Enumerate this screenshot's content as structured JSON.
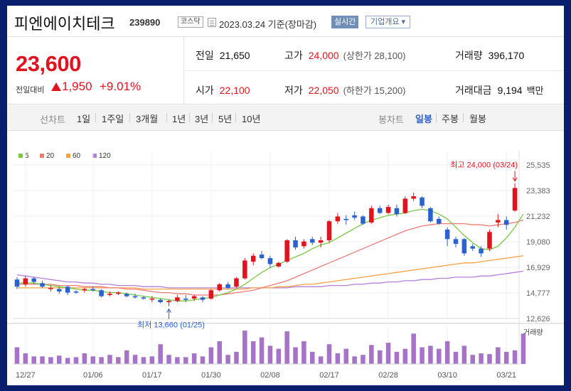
{
  "header": {
    "stock_name": "피엔에이치테크",
    "stock_code": "239890",
    "market": "코스닥",
    "date": "2023.03.24 기준(장마감)",
    "realtime_label": "실시간",
    "company_label": "기업개요 ▾"
  },
  "quote": {
    "price": "23,600",
    "change_label": "전일대비",
    "change": "1,950",
    "change_pct": "+9.01%",
    "prev_close_label": "전일",
    "prev_close": "21,650",
    "high_label": "고가",
    "high": "24,000",
    "upper_limit": "(상한가 28,100)",
    "volume_label": "거래량",
    "volume": "396,170",
    "open_label": "시가",
    "open": "22,100",
    "low_label": "저가",
    "low": "22,050",
    "lower_limit": "(하한가 15,200)",
    "amount_label": "거래대금",
    "amount": "9,194",
    "amount_unit": "백만"
  },
  "period_bar": {
    "line_label": "선차트",
    "line_items": [
      "1일",
      "1주일",
      "3개월",
      "1년",
      "3년",
      "5년",
      "10년"
    ],
    "candle_label": "봉차트",
    "candle_items": [
      "일봉",
      "주봉",
      "월봉"
    ],
    "active_candle": "일봉"
  },
  "colors": {
    "up": "#e0131e",
    "down": "#2a62d0",
    "ma5": "#7ac943",
    "ma20": "#ef7a76",
    "ma60": "#f4a244",
    "ma120": "#b57fd8"
  },
  "chart_data": {
    "type": "candlestick",
    "legend": [
      {
        "name": "5",
        "color": "#7ac943"
      },
      {
        "name": "20",
        "color": "#ef7a76"
      },
      {
        "name": "60",
        "color": "#f4a244"
      },
      {
        "name": "120",
        "color": "#b57fd8"
      }
    ],
    "y_ticks": [
      "25,535",
      "23,383",
      "21,232",
      "19,080",
      "16,929",
      "14,777",
      "12,626"
    ],
    "ylim": [
      12626,
      25535
    ],
    "x_ticks": [
      {
        "label": "12/27",
        "index": 1
      },
      {
        "label": "01/06",
        "index": 9
      },
      {
        "label": "01/17",
        "index": 16
      },
      {
        "label": "01/30",
        "index": 23
      },
      {
        "label": "02/08",
        "index": 30
      },
      {
        "label": "02/17",
        "index": 37
      },
      {
        "label": "02/28",
        "index": 44
      },
      {
        "label": "03/10",
        "index": 51
      },
      {
        "label": "03/21",
        "index": 58
      }
    ],
    "high_annotation": "최고 24,000 (03/24)",
    "high_index": 59,
    "low_annotation": "최저 13,660 (01/25)",
    "low_index": 18,
    "volume_label": "거래량",
    "candles": [
      {
        "o": 15900,
        "h": 16100,
        "l": 15100,
        "c": 15300
      },
      {
        "o": 15500,
        "h": 16200,
        "l": 15300,
        "c": 16000
      },
      {
        "o": 16000,
        "h": 16100,
        "l": 15500,
        "c": 15700
      },
      {
        "o": 15600,
        "h": 15800,
        "l": 15200,
        "c": 15300
      },
      {
        "o": 15100,
        "h": 15400,
        "l": 14900,
        "c": 15200
      },
      {
        "o": 15100,
        "h": 15300,
        "l": 14700,
        "c": 14900
      },
      {
        "o": 15300,
        "h": 15400,
        "l": 14600,
        "c": 14800
      },
      {
        "o": 14900,
        "h": 15000,
        "l": 14700,
        "c": 14800
      },
      {
        "o": 15000,
        "h": 15200,
        "l": 14800,
        "c": 15100
      },
      {
        "o": 15100,
        "h": 15300,
        "l": 14900,
        "c": 15000
      },
      {
        "o": 15000,
        "h": 15100,
        "l": 14400,
        "c": 14500
      },
      {
        "o": 14600,
        "h": 14900,
        "l": 14500,
        "c": 14700
      },
      {
        "o": 14700,
        "h": 14900,
        "l": 14600,
        "c": 14800
      },
      {
        "o": 14700,
        "h": 14800,
        "l": 14400,
        "c": 14500
      },
      {
        "o": 14500,
        "h": 14700,
        "l": 14300,
        "c": 14400
      },
      {
        "o": 14400,
        "h": 14500,
        "l": 14200,
        "c": 14300
      },
      {
        "o": 14300,
        "h": 14500,
        "l": 14000,
        "c": 14300
      },
      {
        "o": 14200,
        "h": 14300,
        "l": 13900,
        "c": 14000
      },
      {
        "o": 14000,
        "h": 14200,
        "l": 13660,
        "c": 14100
      },
      {
        "o": 14100,
        "h": 14600,
        "l": 14000,
        "c": 14400
      },
      {
        "o": 14300,
        "h": 14600,
        "l": 14000,
        "c": 14200
      },
      {
        "o": 14300,
        "h": 14600,
        "l": 14100,
        "c": 14500
      },
      {
        "o": 14400,
        "h": 14500,
        "l": 14000,
        "c": 14200
      },
      {
        "o": 14300,
        "h": 15100,
        "l": 14200,
        "c": 15000
      },
      {
        "o": 15000,
        "h": 15600,
        "l": 14900,
        "c": 15500
      },
      {
        "o": 15500,
        "h": 15700,
        "l": 15100,
        "c": 15200
      },
      {
        "o": 15300,
        "h": 16100,
        "l": 15200,
        "c": 16000
      },
      {
        "o": 16000,
        "h": 17700,
        "l": 15900,
        "c": 17500
      },
      {
        "o": 17400,
        "h": 18100,
        "l": 17100,
        "c": 17900
      },
      {
        "o": 18000,
        "h": 18300,
        "l": 17600,
        "c": 17700
      },
      {
        "o": 17700,
        "h": 17900,
        "l": 16900,
        "c": 17200
      },
      {
        "o": 17000,
        "h": 17400,
        "l": 16900,
        "c": 17300
      },
      {
        "o": 17400,
        "h": 19300,
        "l": 17300,
        "c": 19200
      },
      {
        "o": 19200,
        "h": 19500,
        "l": 18400,
        "c": 18600
      },
      {
        "o": 18700,
        "h": 19300,
        "l": 18500,
        "c": 19100
      },
      {
        "o": 19300,
        "h": 19500,
        "l": 18800,
        "c": 19000
      },
      {
        "o": 19000,
        "h": 19500,
        "l": 18600,
        "c": 19200
      },
      {
        "o": 19200,
        "h": 20900,
        "l": 19000,
        "c": 20800
      },
      {
        "o": 20800,
        "h": 21500,
        "l": 20600,
        "c": 21200
      },
      {
        "o": 21000,
        "h": 21300,
        "l": 20500,
        "c": 20900
      },
      {
        "o": 21300,
        "h": 21600,
        "l": 20900,
        "c": 21100
      },
      {
        "o": 21200,
        "h": 21300,
        "l": 20500,
        "c": 20600
      },
      {
        "o": 20700,
        "h": 22100,
        "l": 20600,
        "c": 21900
      },
      {
        "o": 21900,
        "h": 22100,
        "l": 21400,
        "c": 21500
      },
      {
        "o": 21500,
        "h": 22200,
        "l": 21400,
        "c": 22000
      },
      {
        "o": 21900,
        "h": 22200,
        "l": 21200,
        "c": 21400
      },
      {
        "o": 21500,
        "h": 22900,
        "l": 21400,
        "c": 22700
      },
      {
        "o": 22700,
        "h": 23200,
        "l": 22500,
        "c": 22900
      },
      {
        "o": 22800,
        "h": 22900,
        "l": 21900,
        "c": 22100
      },
      {
        "o": 21900,
        "h": 22000,
        "l": 20700,
        "c": 20800
      },
      {
        "o": 21000,
        "h": 21200,
        "l": 20500,
        "c": 20600
      },
      {
        "o": 20100,
        "h": 20300,
        "l": 18700,
        "c": 19300
      },
      {
        "o": 19300,
        "h": 19500,
        "l": 18600,
        "c": 18900
      },
      {
        "o": 19300,
        "h": 19400,
        "l": 17900,
        "c": 18100
      },
      {
        "o": 18700,
        "h": 18900,
        "l": 18300,
        "c": 18500
      },
      {
        "o": 18500,
        "h": 18700,
        "l": 17800,
        "c": 18100
      },
      {
        "o": 18500,
        "h": 20100,
        "l": 18300,
        "c": 19900
      },
      {
        "o": 20700,
        "h": 21400,
        "l": 20300,
        "c": 20900
      },
      {
        "o": 20900,
        "h": 21200,
        "l": 20100,
        "c": 20500
      },
      {
        "o": 21700,
        "h": 24000,
        "l": 21600,
        "c": 23600
      }
    ],
    "ma5": [
      15600,
      15600,
      15600,
      15500,
      15400,
      15300,
      15200,
      15100,
      15000,
      15000,
      14900,
      14800,
      14800,
      14700,
      14600,
      14500,
      14400,
      14300,
      14200,
      14100,
      14100,
      14200,
      14300,
      14400,
      14600,
      14800,
      15100,
      15500,
      16000,
      16500,
      16900,
      17200,
      17500,
      17800,
      18100,
      18500,
      18800,
      19000,
      19400,
      19800,
      20200,
      20600,
      20900,
      21100,
      21300,
      21400,
      21500,
      21700,
      21800,
      21700,
      21400,
      21000,
      20300,
      19600,
      19000,
      18500,
      18400,
      18700,
      19400,
      20300,
      21400
    ],
    "ma20": [
      15500,
      15500,
      15500,
      15500,
      15500,
      15400,
      15400,
      15400,
      15300,
      15300,
      15300,
      15200,
      15200,
      15100,
      15100,
      15000,
      14900,
      14800,
      14800,
      14700,
      14700,
      14600,
      14600,
      14600,
      14600,
      14700,
      14800,
      14900,
      15000,
      15200,
      15400,
      15600,
      15800,
      16100,
      16400,
      16700,
      17000,
      17300,
      17600,
      17900,
      18200,
      18500,
      18800,
      19100,
      19400,
      19700,
      20000,
      20200,
      20400,
      20500,
      20600,
      20600,
      20600,
      20600,
      20500,
      20500,
      20400,
      20500,
      20600,
      20700,
      20900
    ],
    "ma60": [
      15200,
      15200,
      15200,
      15200,
      15200,
      15200,
      15200,
      15200,
      15200,
      15200,
      15200,
      15200,
      15200,
      15200,
      15200,
      15100,
      15100,
      15100,
      15100,
      15100,
      15100,
      15100,
      15100,
      15100,
      15100,
      15100,
      15100,
      15100,
      15200,
      15200,
      15200,
      15300,
      15300,
      15400,
      15500,
      15500,
      15600,
      15700,
      15800,
      15900,
      16000,
      16100,
      16200,
      16300,
      16400,
      16500,
      16600,
      16700,
      16800,
      16900,
      17000,
      17100,
      17200,
      17300,
      17300,
      17400,
      17500,
      17600,
      17700,
      17800,
      17900
    ],
    "ma120": [
      16300,
      16200,
      16100,
      16000,
      15900,
      15800,
      15700,
      15700,
      15600,
      15600,
      15500,
      15500,
      15400,
      15400,
      15400,
      15300,
      15300,
      15300,
      15200,
      15200,
      15200,
      15200,
      15200,
      15200,
      15200,
      15200,
      15200,
      15200,
      15200,
      15200,
      15200,
      15200,
      15200,
      15300,
      15300,
      15300,
      15300,
      15400,
      15400,
      15400,
      15500,
      15500,
      15600,
      15600,
      15700,
      15700,
      15800,
      15800,
      15900,
      15900,
      16000,
      16000,
      16100,
      16100,
      16100,
      16200,
      16200,
      16300,
      16400,
      16500,
      16600
    ],
    "volume": [
      22,
      14,
      10,
      10,
      9,
      11,
      8,
      9,
      14,
      10,
      9,
      12,
      9,
      18,
      12,
      9,
      10,
      26,
      12,
      9,
      9,
      14,
      10,
      22,
      30,
      12,
      16,
      44,
      30,
      35,
      24,
      20,
      43,
      22,
      30,
      16,
      10,
      26,
      14,
      20,
      10,
      12,
      25,
      18,
      28,
      16,
      20,
      40,
      22,
      24,
      20,
      30,
      16,
      24,
      12,
      14,
      13,
      22,
      16,
      18,
      40
    ]
  }
}
